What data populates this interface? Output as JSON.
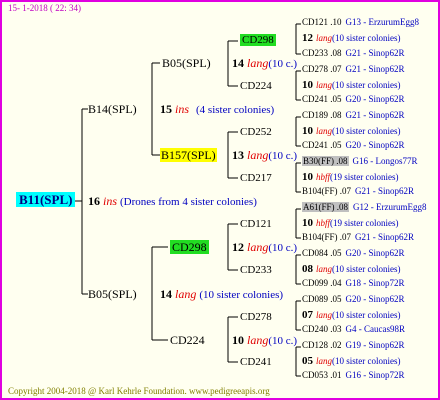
{
  "header": "15-  1-2018 ( 22: 34)",
  "footer": "Copyright 2004-2018 @ Karl Kehrle Foundation.   www.pedigreeapis.org",
  "root": {
    "name": "B11(SPL)"
  },
  "root_annot": {
    "num": "16",
    "word": "ins",
    "note": "(Drones from 4 sister colonies)"
  },
  "g1": [
    {
      "name": "B14(SPL)",
      "num": "15",
      "word": "ins",
      "note": "(4 sister colonies)"
    },
    {
      "name": "B05(SPL)",
      "num": "14",
      "word": "lang",
      "note": "(10 sister colonies)"
    }
  ],
  "g2": [
    {
      "name": "B05(SPL)",
      "num": "14",
      "word": "lang",
      "note": "(10 c.)"
    },
    {
      "name": "B157(SPL)",
      "num": "13",
      "word": "lang",
      "note": "(10 c.)"
    },
    {
      "name": "CD298",
      "num": "12",
      "word": "lang",
      "note": "(10 c.)"
    },
    {
      "name": "CD224",
      "num": "10",
      "word": "lang",
      "note": "(10 c.)"
    }
  ],
  "g3": [
    "CD298",
    "CD224",
    "CD252",
    "CD217",
    "CD121",
    "CD233",
    "CD278",
    "CD241"
  ],
  "g4": [
    {
      "a": "CD121 .10",
      "b": "G13 - ErzurumEgg8",
      "num": "12",
      "word": "lang",
      "note": "(10 sister colonies)"
    },
    {
      "a": "CD233 .08",
      "b": "G21 - Sinop62R"
    },
    {
      "a": "CD278 .07",
      "b": "G21 - Sinop62R",
      "num": "10",
      "word": "lang",
      "note": "(10 sister colonies)"
    },
    {
      "a": "CD241 .05",
      "b": "G20 - Sinop62R"
    },
    {
      "a": "CD189 .08",
      "b": "G21 - Sinop62R",
      "num": "10",
      "word": "lang",
      "note": "(10 sister colonies)"
    },
    {
      "a": "CD241 .05",
      "b": "G20 - Sinop62R"
    },
    {
      "a": "B30(FF) .08",
      "b": "G16 - Longos77R",
      "num": "10",
      "word": "hbff",
      "note": "(19 sister colonies)"
    },
    {
      "a": "B104(FF) .07",
      "b": "G21 - Sinop62R"
    },
    {
      "a": "A61(FF) .08",
      "b": "G12 - ErzurumEgg8",
      "num": "10",
      "word": "hbff",
      "note": "(19 sister colonies)"
    },
    {
      "a": "B104(FF) .07",
      "b": "G21 - Sinop62R"
    },
    {
      "a": "CD084 .05",
      "b": "G20 - Sinop62R",
      "num": "08",
      "word": "lang",
      "note": "(10 sister colonies)"
    },
    {
      "a": "CD099 .04",
      "b": "G18 - Sinop72R"
    },
    {
      "a": "CD089 .05",
      "b": "G20 - Sinop62R",
      "num": "07",
      "word": "lang",
      "note": "(10 sister colonies)"
    },
    {
      "a": "CD240 .03",
      "b": "G4 - Caucas98R"
    },
    {
      "a": "CD128 .02",
      "b": "G19 - Sinop62R",
      "num": "05",
      "word": "lang",
      "note": "(10 sister colonies)"
    },
    {
      "a": "CD053 .01",
      "b": "G16 - Sinop72R"
    }
  ],
  "colors": {
    "border": "#e000e0",
    "background": "#fffff0",
    "root_highlight": "#00ffff",
    "green_highlight": "#22dd22",
    "yellow_highlight": "#ffff00",
    "gray_highlight": "#c0c0c0",
    "red": "#e00000",
    "blue": "#0000c0",
    "olive": "#808000",
    "navy": "#000080"
  }
}
